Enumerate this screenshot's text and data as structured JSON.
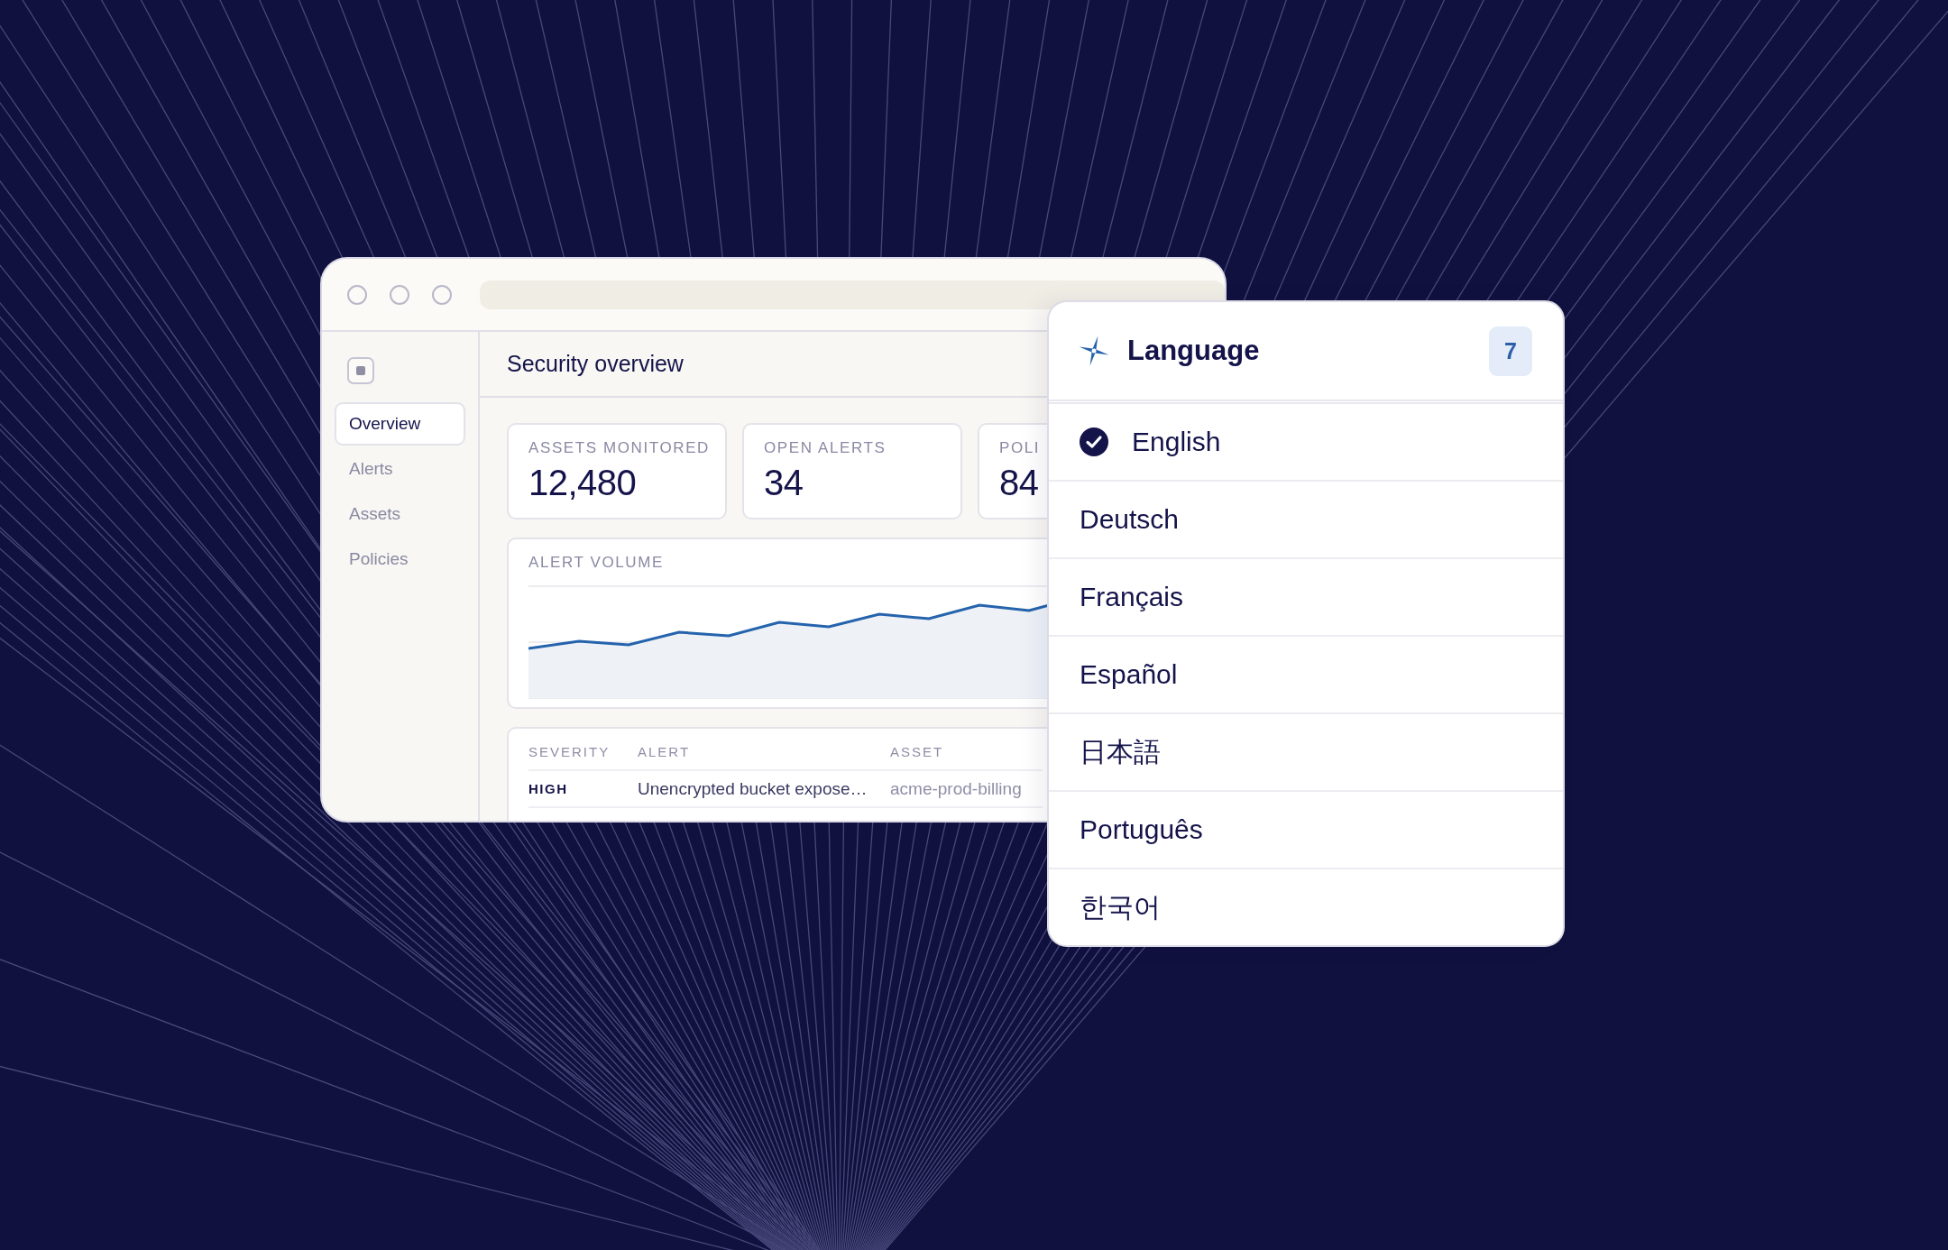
{
  "window": {
    "title": "Security overview",
    "sidebar": {
      "items": [
        {
          "label": "Overview",
          "selected": true
        },
        {
          "label": "Alerts",
          "selected": false
        },
        {
          "label": "Assets",
          "selected": false
        },
        {
          "label": "Policies",
          "selected": false
        }
      ]
    },
    "stats": [
      {
        "label": "ASSETS MONITORED",
        "value": "12,480"
      },
      {
        "label": "OPEN ALERTS",
        "value": "34"
      },
      {
        "label": "POLI",
        "value": "84"
      }
    ],
    "chart": {
      "title": "ALERT VOLUME"
    },
    "table": {
      "columns": [
        "SEVERITY",
        "ALERT",
        "ASSET"
      ],
      "rows": [
        [
          "HIGH",
          "Unencrypted bucket expose…",
          "acme-prod-billing"
        ]
      ]
    }
  },
  "language_menu": {
    "title": "Language",
    "count": "7",
    "items": [
      {
        "label": "English",
        "selected": true
      },
      {
        "label": "Deutsch",
        "selected": false
      },
      {
        "label": "Français",
        "selected": false
      },
      {
        "label": "Español",
        "selected": false
      },
      {
        "label": "日本語",
        "selected": false
      },
      {
        "label": "Português",
        "selected": false
      },
      {
        "label": "한국어",
        "selected": false
      }
    ]
  }
}
